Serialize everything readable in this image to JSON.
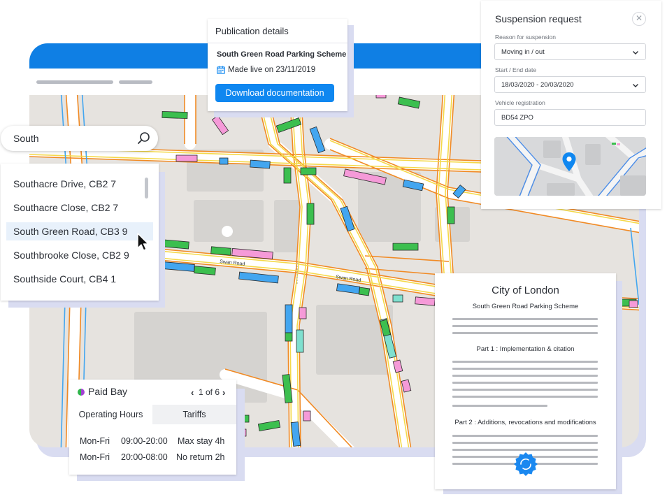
{
  "publication": {
    "header": "Publication details",
    "scheme": "South Green Road Parking Scheme",
    "made_live": "Made live on 23/11/2019",
    "download_label": "Download documentation"
  },
  "search": {
    "query": "South",
    "icon": "search-icon"
  },
  "suggestions": {
    "items": [
      "Southacre Drive, CB2 7",
      "Southacre Close, CB2 7",
      "South Green Road, CB3 9",
      "Southbrooke Close, CB2 9",
      "Southside Court, CB4 1"
    ],
    "selected_index": 2
  },
  "suspension": {
    "title": "Suspension request",
    "reason_label": "Reason for suspension",
    "reason_value": "Moving in / out",
    "dates_label": "Start / End date",
    "dates_value": "18/03/2020 - 20/03/2020",
    "vehicle_label": "Vehicle registration",
    "vehicle_value": "BD54 ZPO",
    "close_icon": "close-icon"
  },
  "map": {
    "labels": {
      "swan_road_1": "Swan Road",
      "swan_road_2": "Swan Road"
    }
  },
  "paid_bay": {
    "title": "Paid Bay",
    "pager": "1 of 6",
    "tabs": [
      "Operating Hours",
      "Tariffs"
    ],
    "active_tab": "Operating Hours",
    "rows": [
      {
        "days": "Mon-Fri",
        "hours": "09:00-20:00",
        "rule": "Max stay 4h"
      },
      {
        "days": "Mon-Fri",
        "hours": "20:00-08:00",
        "rule": "No return 2h"
      }
    ]
  },
  "document": {
    "title": "City of London",
    "subtitle": "South Green Road Parking Scheme",
    "part1": "Part 1 : Implementation & citation",
    "part2": "Part 2 : Additions, revocations and modifications"
  },
  "colors": {
    "primary": "#0f7fe4",
    "button": "#0f87f0",
    "bay_green": "#3cbf4f",
    "bay_blue": "#43a6f0",
    "bay_pink": "#f59ad8",
    "road_orange": "#f18a24",
    "road_yellow": "#f4d94a",
    "map_background": "#e6e3df"
  }
}
